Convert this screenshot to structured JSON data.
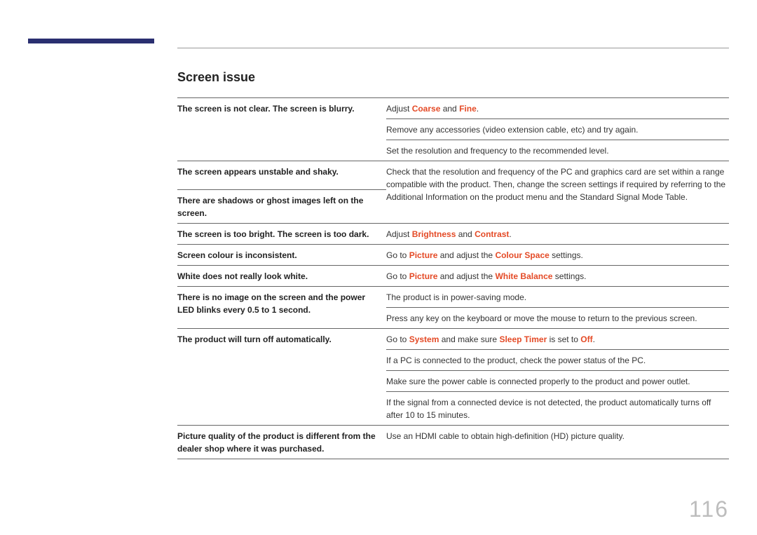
{
  "section_title": "Screen issue",
  "page_number": "116",
  "rows": [
    {
      "left": "The screen is not clear. The screen is blurry.",
      "right_pre": "Adjust ",
      "hl1": "Coarse",
      "mid": " and ",
      "hl2": "Fine",
      "right_post": "."
    },
    {
      "left": "",
      "right": "Remove any accessories (video extension cable, etc) and try again."
    },
    {
      "left": "",
      "right": "Set the resolution and frequency to the recommended level."
    },
    {
      "left": "The screen appears unstable and shaky.",
      "right": "Check that the resolution and frequency of the PC and graphics card are set within a range compatible with the product. Then, change the screen settings if required by referring to the Additional Information on the product menu and the Standard Signal Mode Table.",
      "left2": "There are shadows or ghost images left on the screen."
    },
    {
      "left": "The screen is too bright. The screen is too dark.",
      "right_pre": "Adjust ",
      "hl1": "Brightness",
      "mid": " and ",
      "hl2": "Contrast",
      "right_post": "."
    },
    {
      "left": "Screen colour is inconsistent.",
      "right_pre": "Go to ",
      "hl1": "Picture",
      "mid": " and adjust the ",
      "hl2": "Colour Space",
      "right_post": " settings."
    },
    {
      "left": "White does not really look white.",
      "right_pre": "Go to ",
      "hl1": "Picture",
      "mid": " and adjust the ",
      "hl2": "White Balance",
      "right_post": " settings."
    },
    {
      "left": "There is no image on the screen and the power LED blinks every 0.5 to 1 second.",
      "right": "The product is in power-saving mode."
    },
    {
      "left": "",
      "right": "Press any key on the keyboard or move the mouse to return to the previous screen."
    },
    {
      "left": "The product will turn off automatically.",
      "right_pre": "Go to ",
      "hl1": "System",
      "mid": " and make sure ",
      "hl2": "Sleep Timer",
      "mid2": " is set to ",
      "hl3": "Off",
      "right_post": "."
    },
    {
      "left": "",
      "right": "If a PC is connected to the product, check the power status of the PC."
    },
    {
      "left": "",
      "right": "Make sure the power cable is connected properly to the product and power outlet."
    },
    {
      "left": "",
      "right": "If the signal from a connected device is not detected, the product automatically turns off after 10 to 15 minutes."
    },
    {
      "left": "Picture quality of the product is different from the dealer shop where it was purchased.",
      "right": "Use an HDMI cable to obtain high-definition (HD) picture quality."
    }
  ]
}
